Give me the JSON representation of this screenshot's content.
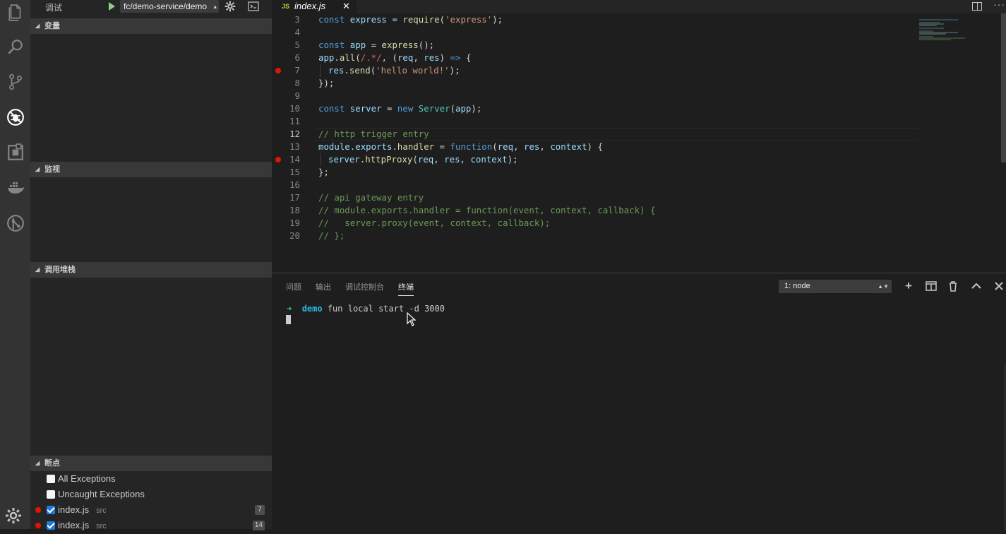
{
  "activity_bar": {
    "icons": [
      "explorer-icon",
      "search-icon",
      "source-control-icon",
      "debug-icon",
      "extensions-icon",
      "docker-icon",
      "gitlens-icon",
      "settings-gear-icon"
    ]
  },
  "debug_toolbar": {
    "title": "调试",
    "config_select_value": "fc/demo-service/demo"
  },
  "sidebar": {
    "sections": {
      "variables": "变量",
      "watch": "监视",
      "call_stack": "调用堆栈",
      "breakpoints": "断点"
    },
    "breakpoints": {
      "all_exceptions": "All Exceptions",
      "uncaught_exceptions": "Uncaught Exceptions",
      "items": [
        {
          "file": "index.js",
          "path": "src",
          "line": "7"
        },
        {
          "file": "index.js",
          "path": "src",
          "line": "14"
        }
      ]
    }
  },
  "editor": {
    "tab_name": "index.js",
    "tab_icon_text": "JS",
    "close_glyph": "✕",
    "current_line": "12",
    "lines": [
      {
        "n": "3",
        "bp": false
      },
      {
        "n": "4",
        "bp": false
      },
      {
        "n": "5",
        "bp": false
      },
      {
        "n": "6",
        "bp": false
      },
      {
        "n": "7",
        "bp": true
      },
      {
        "n": "8",
        "bp": false
      },
      {
        "n": "9",
        "bp": false
      },
      {
        "n": "10",
        "bp": false
      },
      {
        "n": "11",
        "bp": false
      },
      {
        "n": "12",
        "bp": false
      },
      {
        "n": "13",
        "bp": false
      },
      {
        "n": "14",
        "bp": true
      },
      {
        "n": "15",
        "bp": false
      },
      {
        "n": "16",
        "bp": false
      },
      {
        "n": "17",
        "bp": false
      },
      {
        "n": "18",
        "bp": false
      },
      {
        "n": "19",
        "bp": false
      },
      {
        "n": "20",
        "bp": false
      }
    ],
    "code": {
      "l3_a": "const",
      "l3_b": " express = ",
      "l3_c": "require",
      "l3_d": "(",
      "l3_e": "'express'",
      "l3_f": ");",
      "l5_a": "const",
      "l5_b": " app",
      "l5_c": " = ",
      "l5_d": "express",
      "l5_e": "();",
      "l6_a": "app",
      "l6_b": ".",
      "l6_c": "all",
      "l6_d": "(",
      "l6_e": "/.*/",
      "l6_f": ", (",
      "l6_g": "req",
      "l6_h": ", ",
      "l6_i": "res",
      "l6_j": ") ",
      "l6_k": "=>",
      "l6_l": " {",
      "l7_a": "res",
      "l7_b": ".",
      "l7_c": "send",
      "l7_d": "(",
      "l7_e": "'hello world!'",
      "l7_f": ");",
      "l8": "});",
      "l10_a": "const",
      "l10_b": " server",
      "l10_c": " = ",
      "l10_d": "new",
      "l10_e": " ",
      "l10_f": "Server",
      "l10_g": "(",
      "l10_h": "app",
      "l10_i": ");",
      "l12": "// http trigger entry",
      "l13_a": "module",
      "l13_b": ".",
      "l13_c": "exports",
      "l13_d": ".",
      "l13_e": "handler",
      "l13_f": " = ",
      "l13_g": "function",
      "l13_h": "(",
      "l13_i": "req",
      "l13_j": ", ",
      "l13_k": "res",
      "l13_l": ", ",
      "l13_m": "context",
      "l13_n": ") {",
      "l14_a": "server",
      "l14_b": ".",
      "l14_c": "httpProxy",
      "l14_d": "(",
      "l14_e": "req",
      "l14_f": ", ",
      "l14_g": "res",
      "l14_h": ", ",
      "l14_i": "context",
      "l14_j": ");",
      "l15": "};",
      "l17": "// api gateway entry",
      "l18": "// module.exports.handler = function(event, context, callback) {",
      "l19": "//   server.proxy(event, context, callback);",
      "l20": "// };"
    }
  },
  "panel": {
    "tabs": [
      "问题",
      "输出",
      "调试控制台",
      "终端"
    ],
    "active_tab": "终端",
    "terminal_select_value": "1: node",
    "terminal": {
      "arrow": "➜",
      "dir": "demo",
      "command": " fun local start -d 3000"
    }
  }
}
